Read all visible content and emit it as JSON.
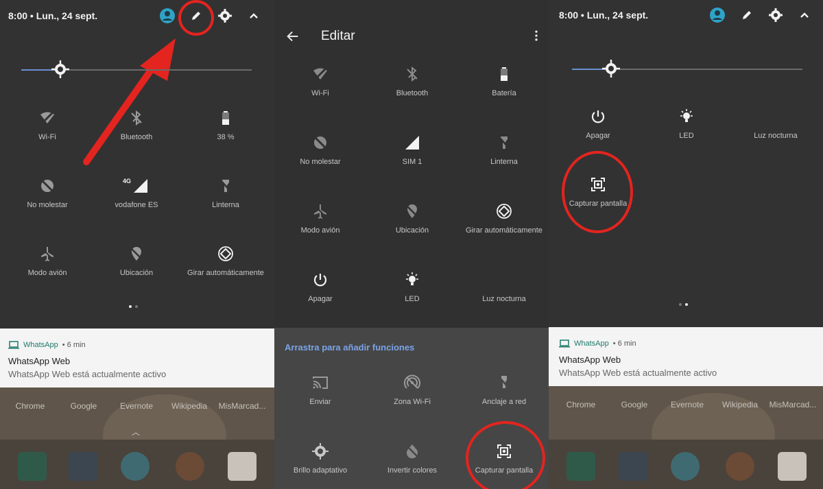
{
  "status": {
    "time": "8:00",
    "date": "Lun., 24 sept."
  },
  "panel1": {
    "tiles": [
      {
        "label": "Wi-Fi",
        "icon": "wifi-off-icon"
      },
      {
        "label": "Bluetooth",
        "icon": "bluetooth-off-icon"
      },
      {
        "label": "38 %",
        "icon": "battery-icon"
      },
      {
        "label": "No molestar",
        "icon": "do-not-disturb-icon"
      },
      {
        "label": "vodafone ES",
        "icon": "signal-icon",
        "badge": "4G"
      },
      {
        "label": "Linterna",
        "icon": "flashlight-off-icon"
      },
      {
        "label": "Modo avión",
        "icon": "airplane-icon"
      },
      {
        "label": "Ubicación",
        "icon": "location-off-icon"
      },
      {
        "label": "Girar automáticamente",
        "icon": "auto-rotate-icon"
      }
    ],
    "brightness_level": 0.17
  },
  "panel2": {
    "title": "Editar",
    "tiles": [
      {
        "label": "Wi-Fi",
        "icon": "wifi-off-icon"
      },
      {
        "label": "Bluetooth",
        "icon": "bluetooth-off-icon"
      },
      {
        "label": "Batería",
        "icon": "battery-icon"
      },
      {
        "label": "No molestar",
        "icon": "do-not-disturb-icon"
      },
      {
        "label": "SIM 1",
        "icon": "signal-icon"
      },
      {
        "label": "Linterna",
        "icon": "flashlight-off-icon"
      },
      {
        "label": "Modo avión",
        "icon": "airplane-icon"
      },
      {
        "label": "Ubicación",
        "icon": "location-off-icon"
      },
      {
        "label": "Girar automáticamente",
        "icon": "auto-rotate-icon"
      },
      {
        "label": "Apagar",
        "icon": "power-icon"
      },
      {
        "label": "LED",
        "icon": "led-icon"
      },
      {
        "label": "Luz nocturna",
        "icon": "night-light-icon"
      }
    ],
    "drag_hint": "Arrastra para añadir funciones",
    "available_tiles": [
      {
        "label": "Enviar",
        "icon": "cast-icon"
      },
      {
        "label": "Zona Wi-Fi",
        "icon": "hotspot-icon"
      },
      {
        "label": "Anclaje a red",
        "icon": "tethering-icon"
      },
      {
        "label": "Brillo adaptativo",
        "icon": "adaptive-brightness-icon"
      },
      {
        "label": "Invertir colores",
        "icon": "invert-colors-icon"
      },
      {
        "label": "Capturar pantalla",
        "icon": "screenshot-icon"
      }
    ]
  },
  "panel3": {
    "tiles": [
      {
        "label": "Apagar",
        "icon": "power-icon"
      },
      {
        "label": "LED",
        "icon": "led-icon"
      },
      {
        "label": "Luz nocturna",
        "icon": "night-light-icon"
      },
      {
        "label": "Capturar pantalla",
        "icon": "screenshot-icon"
      }
    ],
    "brightness_level": 0.17
  },
  "notification": {
    "app": "WhatsApp",
    "time": "6 min",
    "title": "WhatsApp Web",
    "text": "WhatsApp Web está actualmente activo"
  },
  "homescreen": {
    "apps": [
      "Chrome",
      "Google",
      "Evernote",
      "Wikipedia",
      "MisMarcad..."
    ]
  },
  "colors": {
    "panel_bg": "#323232",
    "accent_blue": "#6b8fd1",
    "highlight_red": "#e3241f",
    "whatsapp_green": "#1e7a6b"
  }
}
